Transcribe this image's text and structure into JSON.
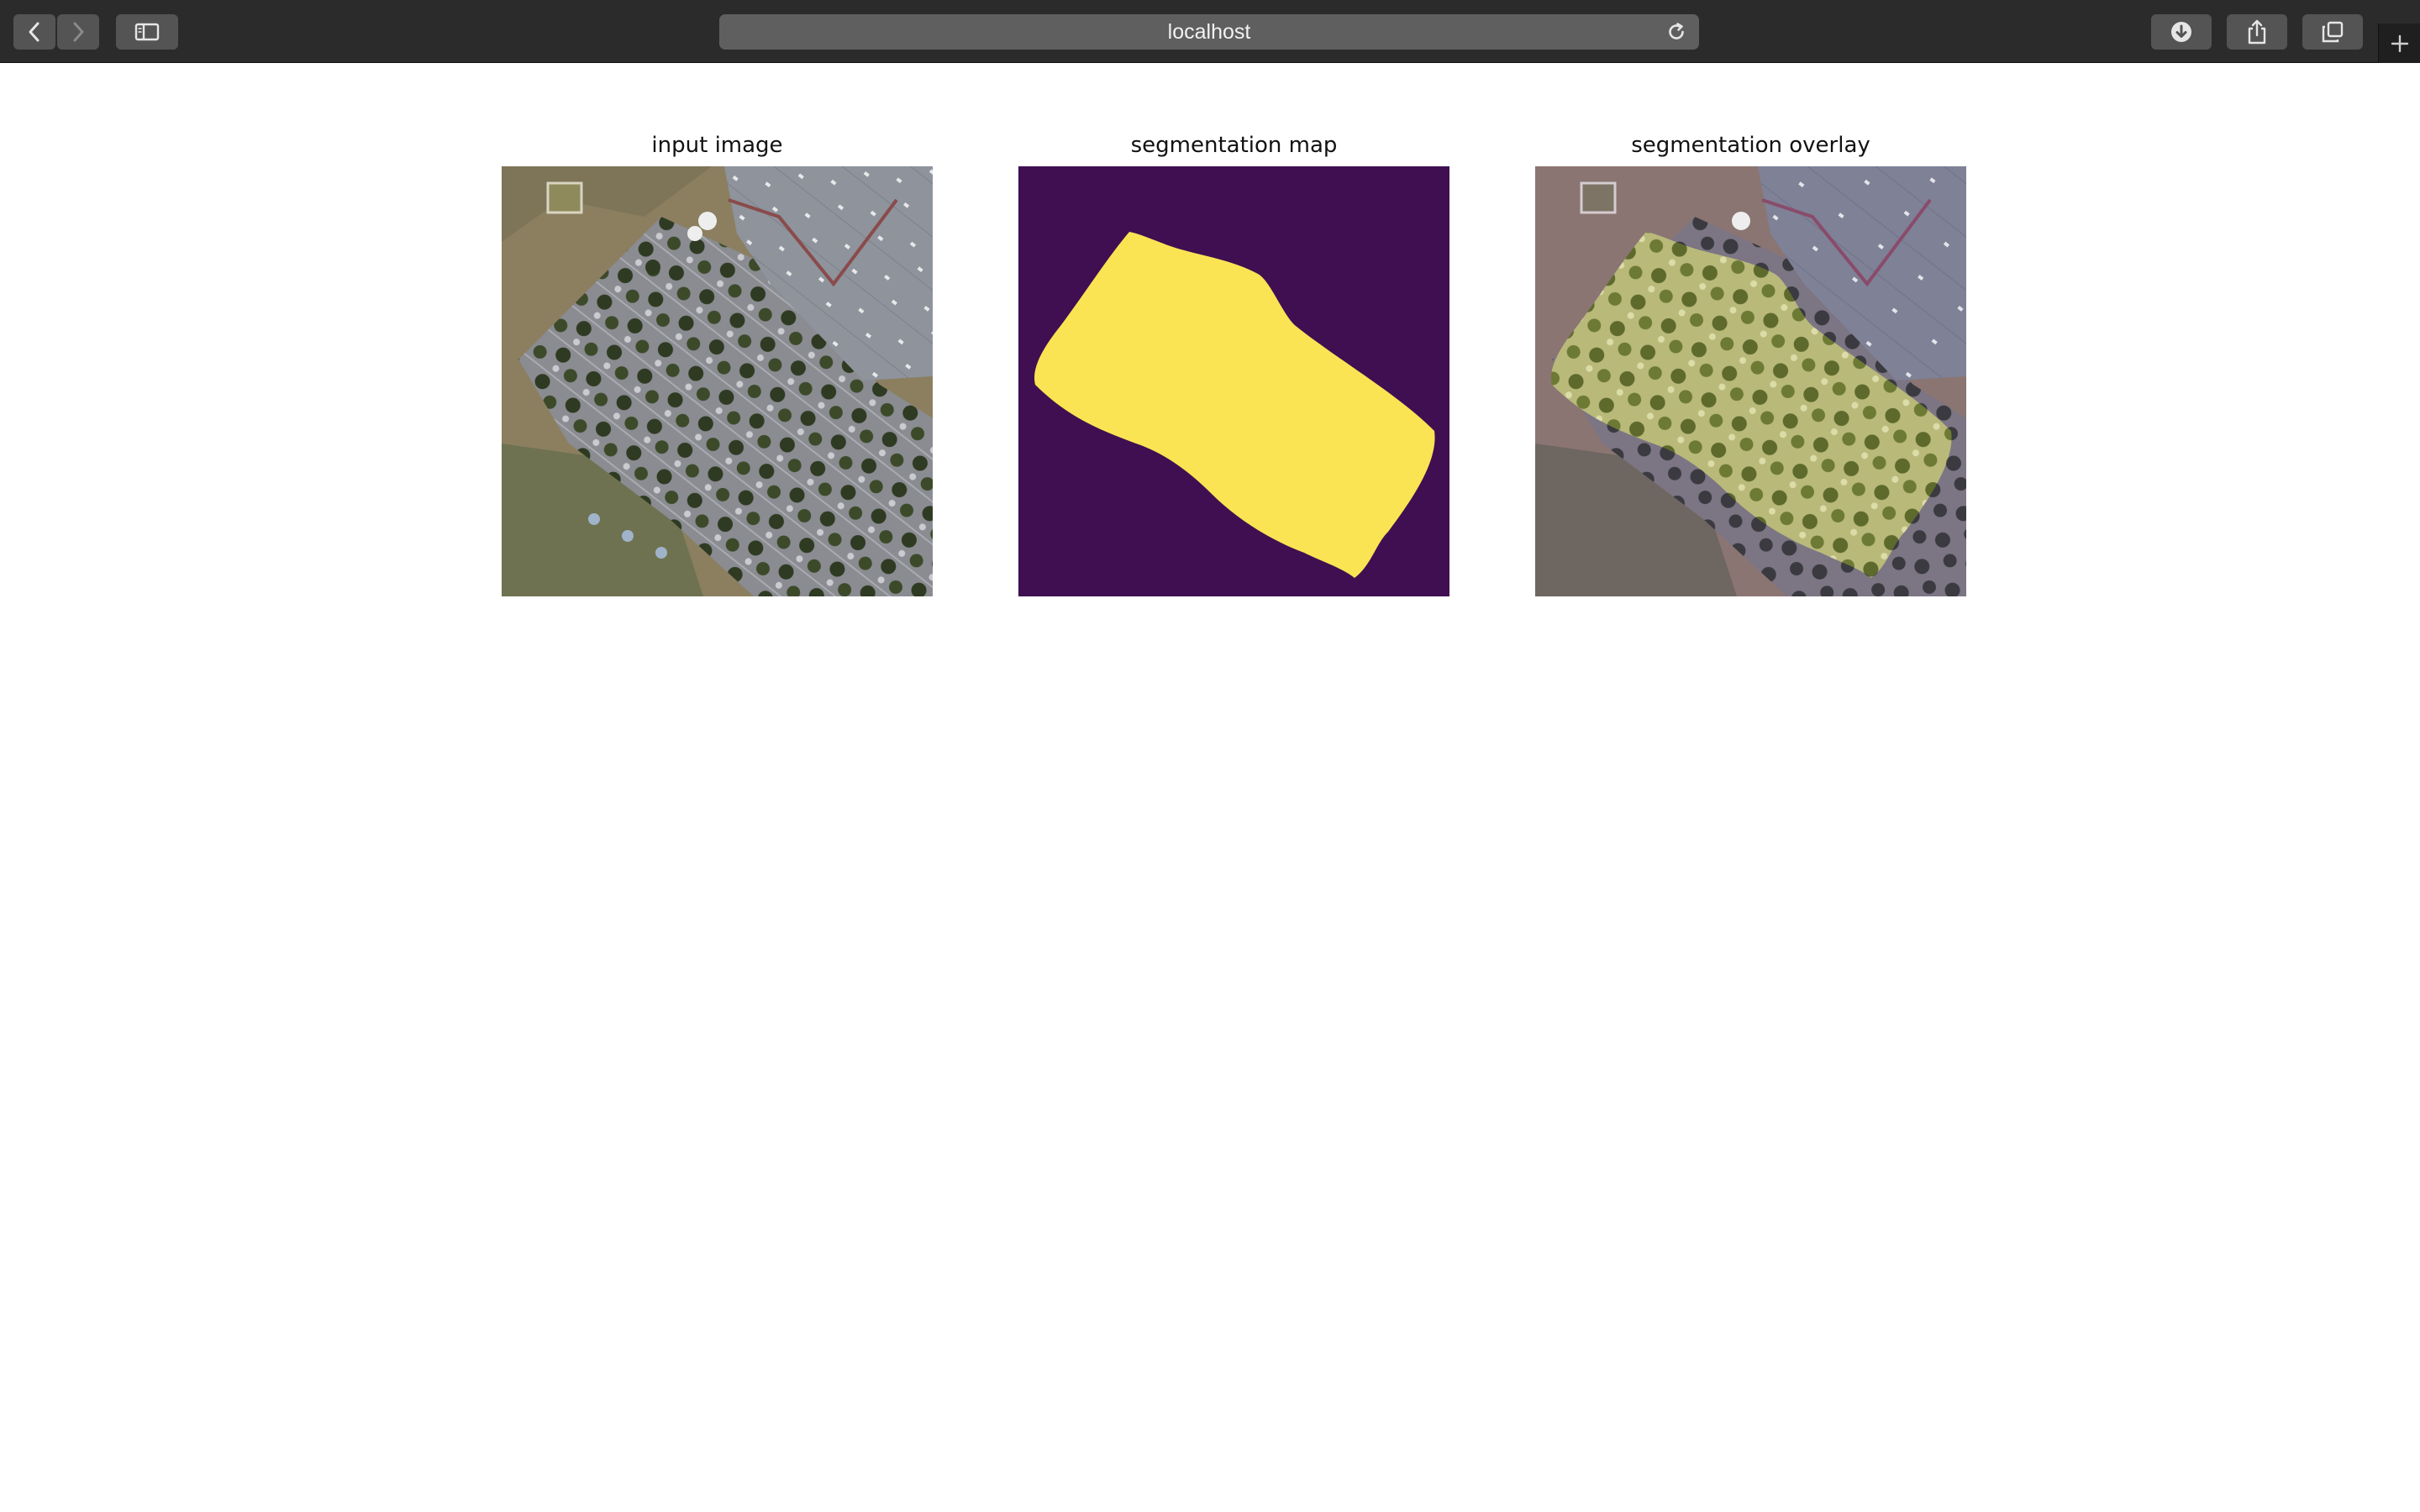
{
  "browser": {
    "url": "localhost",
    "icons": {
      "back": "chevron-left-icon",
      "forward": "chevron-right-icon",
      "sidebar": "sidebar-icon",
      "reload": "reload-icon",
      "downloads": "download-icon",
      "share": "share-icon",
      "tabs": "tabs-overview-icon",
      "new_tab": "plus-icon"
    }
  },
  "panels": [
    {
      "title": "input image"
    },
    {
      "title": "segmentation map"
    },
    {
      "title": "segmentation overlay"
    }
  ],
  "colors": {
    "toolbar": "#2b2b2b",
    "segment_background": "#3f0f52",
    "segment_foreground": "#fbe453"
  }
}
